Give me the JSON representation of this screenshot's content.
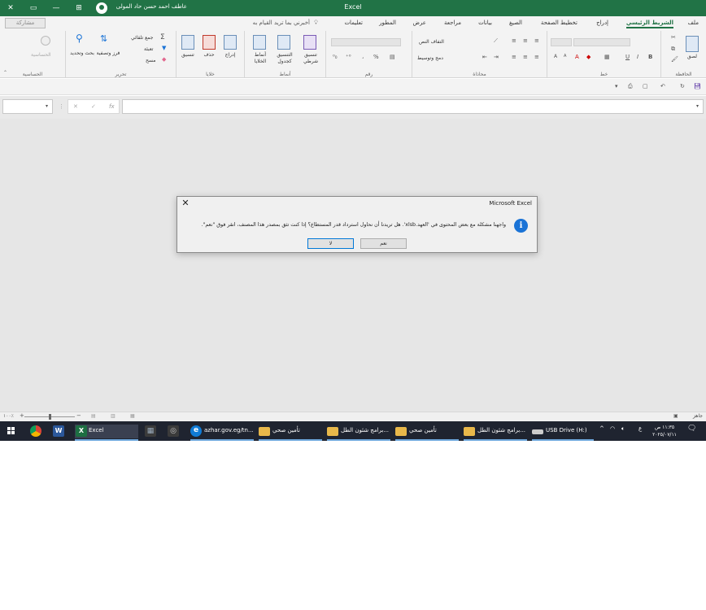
{
  "titlebar": {
    "app_title": "Excel",
    "user_name": "عاطف احمد حسن حاد المولى",
    "close_glyph": "✕",
    "maximize_glyph": "▭",
    "minimize_glyph": "—",
    "ribbon_display_glyph": "⊞",
    "accent": "#217346"
  },
  "tabs": {
    "items": [
      "ملف",
      "الشريط الرئيسي",
      "إدراج",
      "تخطيط الصفحة",
      "الصيغ",
      "بيانات",
      "مراجعة",
      "عرض",
      "المطور",
      "تعليمات"
    ],
    "active": "الشريط الرئيسي",
    "tell_me": "أخبرني بما تريد القيام به",
    "share": "مشاركة"
  },
  "ribbon": {
    "clipboard": {
      "paste": "لصق",
      "label": "الحافظة"
    },
    "font": {
      "bold": "B",
      "italic": "I",
      "underline": "U",
      "grow": "A",
      "shrink": "A",
      "color": "A",
      "label": "خط"
    },
    "alignment": {
      "wrap": "التفاف النص",
      "merge": "دمج وتوسيط",
      "label": "محاذاة"
    },
    "number": {
      "percent": "%",
      "comma": "،",
      "label": "رقم"
    },
    "styles": {
      "conditional": "تنسيق شرطي",
      "as_table": "التنسيق كجدول",
      "cell_styles": "أنماط الخلايا",
      "label": "أنماط"
    },
    "cells": {
      "insert": "إدراج",
      "delete": "حذف",
      "format": "تنسيق",
      "label": "خلايا"
    },
    "editing": {
      "autosum": "جمع تلقائي",
      "fill": "تعبئة",
      "clear": "مسح",
      "sort": "فرز وتصفية",
      "find": "بحث وتحديد",
      "label": "تحرير"
    },
    "sensitivity": {
      "button": "الحساسية",
      "label": "الحساسية"
    }
  },
  "formula_bar": {
    "fx": "fx",
    "cancel": "✕",
    "enter": "✓"
  },
  "statusbar": {
    "ready": "جاهز",
    "zoom": "١٠٠٪"
  },
  "taskbar": {
    "apps": [
      {
        "label": "Excel",
        "color": "#1d6f42",
        "letter": "X"
      },
      {
        "label": "",
        "color": "#3b3b3b",
        "letter": "▦"
      },
      {
        "label": "",
        "color": "#3b3b3b",
        "letter": "◎"
      },
      {
        "label": "azhar.gov.eg/tn...",
        "color": "#0f7bd6",
        "letter": "e"
      },
      {
        "label": "تأمين صحي",
        "color": "#e8b84a",
        "letter": ""
      },
      {
        "label": "برامج شئون الطل...",
        "color": "#e8b84a",
        "letter": ""
      },
      {
        "label": "تأمين صحي",
        "color": "#e8b84a",
        "letter": ""
      },
      {
        "label": "برامج شئون الطل...",
        "color": "#e8b84a",
        "letter": ""
      },
      {
        "label": "USB Drive (H:)",
        "color": "#cccccc",
        "letter": ""
      }
    ],
    "word_letter": "W",
    "tray_chevron": "^",
    "tray_lang": "ع",
    "clock_time": "١١:٣٥ ص",
    "clock_date": "٢٠٢٥/٠٧/١١"
  },
  "dialog": {
    "title": "Microsoft Excel",
    "close": "✕",
    "info_icon": "i",
    "message": "واجهنا مشكلة مع بعض المحتوى في 'العهد.xlsb'. هل تريدنا أن نحاول استرداد قدر المستطاع؟ إذا كنت تثق بمصدر هذا المصنف، انقر فوق \"نعم\".",
    "yes_button": "نعم",
    "no_button": "لا"
  }
}
